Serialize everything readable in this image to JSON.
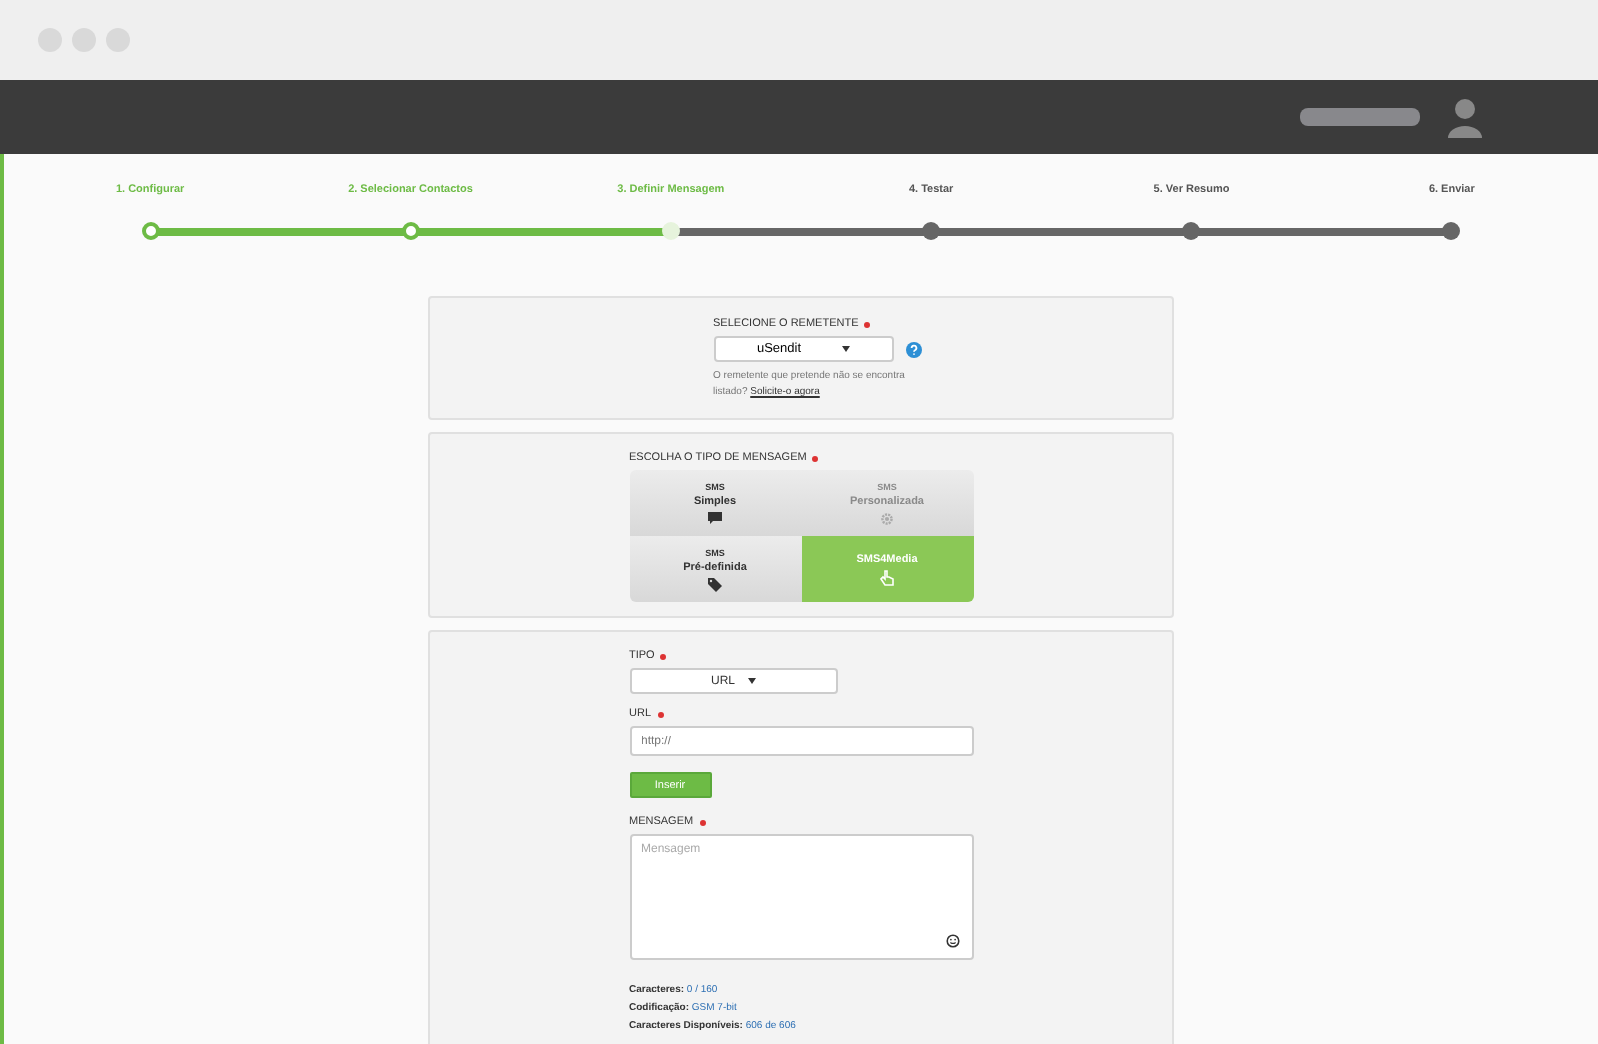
{
  "steps": [
    {
      "label": "1. Configurar",
      "completed": true,
      "current": false
    },
    {
      "label": "2. Selecionar Contactos",
      "completed": true,
      "current": false
    },
    {
      "label": "3. Definir Mensagem",
      "completed": false,
      "current": true
    },
    {
      "label": "4. Testar",
      "completed": false,
      "current": false
    },
    {
      "label": "5. Ver Resumo",
      "completed": false,
      "current": false
    },
    {
      "label": "6. Enviar",
      "completed": false,
      "current": false
    }
  ],
  "sender": {
    "label": "SELECIONE O REMETENTE",
    "value": "uSendit",
    "hint": "O remetente que pretende não se encontra listado?",
    "link": "Solicite-o agora"
  },
  "message_type": {
    "label": "ESCOLHA O TIPO DE MENSAGEM",
    "options": [
      {
        "line1": "SMS",
        "line2": "Simples",
        "kind": "chat",
        "selected": false,
        "disabled": false
      },
      {
        "line1": "SMS",
        "line2": "Personalizada",
        "kind": "gear",
        "selected": false,
        "disabled": true
      },
      {
        "line1": "SMS",
        "line2": "Pré-definida",
        "kind": "tag",
        "selected": false,
        "disabled": false
      },
      {
        "line1": "SMS4Media",
        "kind": "hand",
        "selected": true,
        "disabled": false
      }
    ]
  },
  "form": {
    "type_label": "TIPO",
    "type_value": "URL",
    "url_label": "URL",
    "url_placeholder": "http://",
    "insert_button": "Inserir",
    "message_label": "MENSAGEM",
    "message_placeholder": "Mensagem",
    "stats": [
      {
        "label": "Caracteres:",
        "value": "0 / 160"
      },
      {
        "label": "Codificação:",
        "value": "GSM 7-bit"
      },
      {
        "label": "Caracteres Disponíveis:",
        "value": "606 de 606"
      }
    ]
  }
}
